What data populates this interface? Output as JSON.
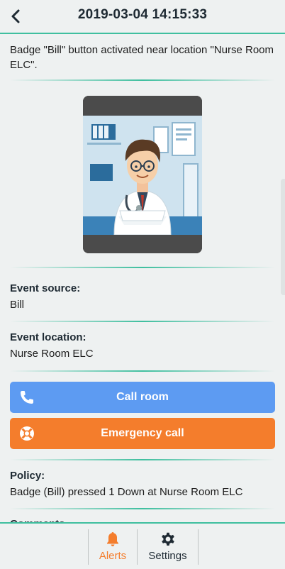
{
  "header": {
    "title": "2019-03-04 14:15:33",
    "back_icon": "chevron-left-icon"
  },
  "event": {
    "description": "Badge \"Bill\" button activated near location \"Nurse Room ELC\".",
    "image_alt": "doctor-avatar"
  },
  "details": {
    "source_label": "Event source:",
    "source_value": "Bill",
    "location_label": "Event location:",
    "location_value": "Nurse Room ELC",
    "policy_label": "Policy:",
    "policy_value": "Badge (Bill) pressed 1 Down at Nurse Room ELC",
    "next_label_partial": "Comments"
  },
  "actions": {
    "call_label": "Call room",
    "call_icon": "phone-icon",
    "call_color": "#5d9bf2",
    "emergency_label": "Emergency call",
    "emergency_icon": "lifebuoy-icon",
    "emergency_color": "#f47d2c"
  },
  "tabs": [
    {
      "label": "Alerts",
      "icon": "bell-icon",
      "active": true,
      "color": "#f47d2c"
    },
    {
      "label": "Settings",
      "icon": "gear-icon",
      "active": false,
      "color": "#1e2a33"
    }
  ],
  "accent": "#3fbf9f"
}
